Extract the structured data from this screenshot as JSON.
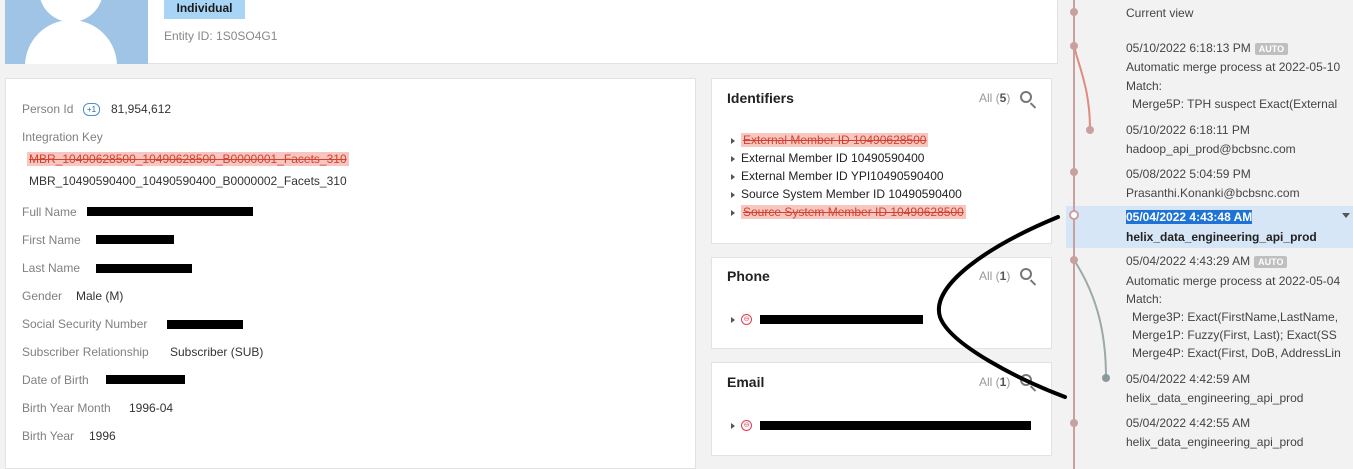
{
  "header": {
    "entity_type": "Individual",
    "entity_id": "Entity ID: 1S0SO4G1"
  },
  "person": {
    "person_id_label": "Person Id",
    "person_id_icon_text": "+1",
    "person_id_value": "81,954,612",
    "integration_key_label": "Integration Key",
    "integration_keys": [
      "MBR_10490628500_10490628500_B0000001_Facets_310",
      "MBR_10490590400_10490590400_B0000002_Facets_310"
    ],
    "full_name_label": "Full Name",
    "first_name_label": "First Name",
    "last_name_label": "Last Name",
    "gender_label": "Gender",
    "gender_value": "Male (M)",
    "ssn_label": "Social Security Number",
    "subscriber_rel_label": "Subscriber Relationship",
    "subscriber_rel_value": "Subscriber (SUB)",
    "dob_label": "Date of Birth",
    "birth_year_month_label": "Birth Year Month",
    "birth_year_month_value": "1996-04",
    "birth_year_label": "Birth Year",
    "birth_year_value": "1996"
  },
  "identifiers": {
    "title": "Identifiers",
    "all_prefix": "All (",
    "count": "5",
    "all_suffix": ")",
    "items": [
      "External Member ID 10490628500",
      "External Member ID 10490590400",
      "External Member ID YPI10490590400",
      "Source System Member ID 10490590400",
      "Source System Member ID 10490628500"
    ]
  },
  "phone": {
    "title": "Phone",
    "all_prefix": "All (",
    "count": "1",
    "all_suffix": ")"
  },
  "email": {
    "title": "Email",
    "all_prefix": "All (",
    "count": "1",
    "all_suffix": ")"
  },
  "timeline": {
    "current_view": "Current view",
    "auto_badge": "AUTO",
    "events": [
      {
        "date": "05/10/2022 6:18:13 PM",
        "line1": "Automatic merge process at 2022-05-10",
        "line2": "Match:",
        "line3": "Merge5P: TPH suspect Exact(External"
      },
      {
        "date": "05/10/2022 6:18:11 PM",
        "line1": "hadoop_api_prod@bcbsnc.com"
      },
      {
        "date": "05/08/2022 5:04:59 PM",
        "line1": "Prasanthi.Konanki@bcbsnc.com"
      },
      {
        "date": "05/04/2022 4:43:48 AM",
        "line1": "helix_data_engineering_api_prod"
      },
      {
        "date": "05/04/2022 4:43:29 AM",
        "line1": "Automatic merge process at 2022-05-04",
        "line2": "Match:",
        "line3": "Merge3P: Exact(FirstName,LastName,",
        "line4": "Merge1P: Fuzzy(First, Last); Exact(SS",
        "line5": "Merge4P: Exact(First, DoB, AddressLin"
      },
      {
        "date": "05/04/2022 4:42:59 AM",
        "line1": "helix_data_engineering_api_prod"
      },
      {
        "date": "05/04/2022 4:42:55 AM",
        "line1": "helix_data_engineering_api_prod"
      }
    ]
  },
  "colors": {
    "accent": "#1f73d6",
    "badge": "#a8d4f5",
    "strike": "#d4412f"
  }
}
